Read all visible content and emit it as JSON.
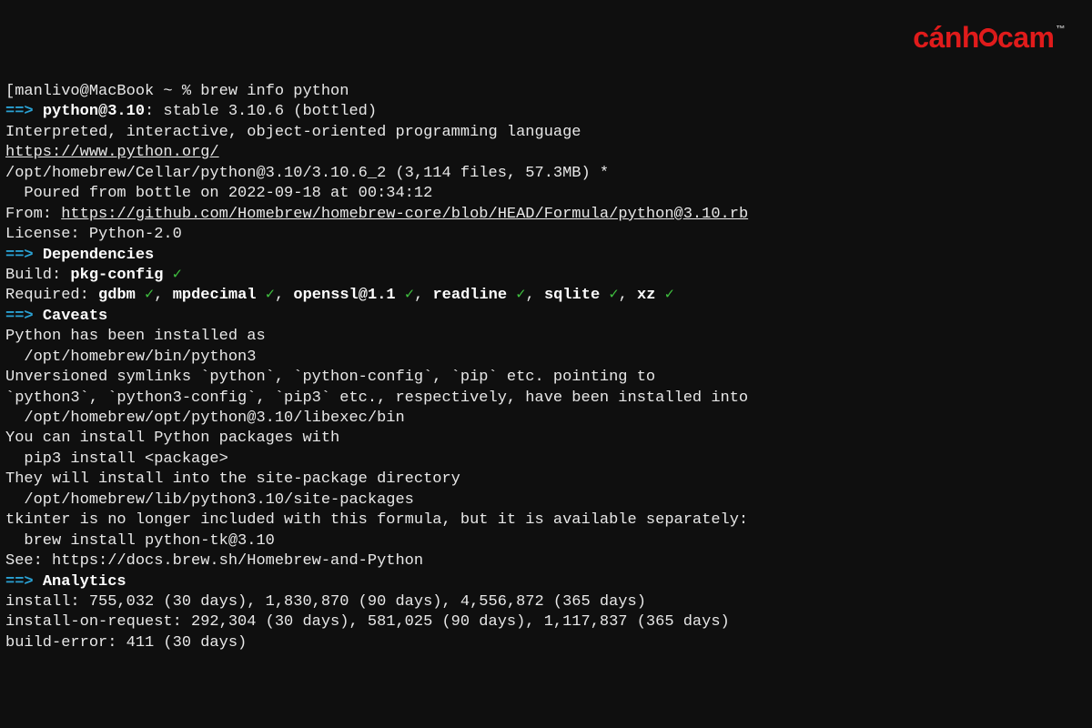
{
  "logo": {
    "text": "cánh",
    "text2": "cam",
    "tm": "™"
  },
  "prompt": "[manlivo@MacBook ~ % brew info python",
  "pkg_head": {
    "arrow": "==>",
    "name": "python@3.10",
    "rest": ": stable 3.10.6 (bottled)"
  },
  "desc": "Interpreted, interactive, object-oriented programming language",
  "homepage": "https://www.python.org/",
  "cellar": "/opt/homebrew/Cellar/python@3.10/3.10.6_2 (3,114 files, 57.3MB) *",
  "poured": "  Poured from bottle on 2022-09-18 at 00:34:12",
  "from_label": "From: ",
  "from_url": "https://github.com/Homebrew/homebrew-core/blob/HEAD/Formula/python@3.10.rb",
  "license": "License: Python-2.0",
  "deps_header": {
    "arrow": "==>",
    "label": "Dependencies"
  },
  "build_label": "Build: ",
  "build_pkg": "pkg-config",
  "check": "✓",
  "req_label": "Required: ",
  "req": [
    "gdbm",
    "mpdecimal",
    "openssl@1.1",
    "readline",
    "sqlite",
    "xz"
  ],
  "caveats_header": {
    "arrow": "==>",
    "label": "Caveats"
  },
  "caveats": [
    "Python has been installed as",
    "  /opt/homebrew/bin/python3",
    "",
    "Unversioned symlinks `python`, `python-config`, `pip` etc. pointing to",
    "`python3`, `python3-config`, `pip3` etc., respectively, have been installed into",
    "  /opt/homebrew/opt/python@3.10/libexec/bin",
    "",
    "You can install Python packages with",
    "  pip3 install <package>",
    "They will install into the site-package directory",
    "  /opt/homebrew/lib/python3.10/site-packages",
    "",
    "tkinter is no longer included with this formula, but it is available separately:",
    "  brew install python-tk@3.10",
    "",
    "See: https://docs.brew.sh/Homebrew-and-Python"
  ],
  "analytics_header": {
    "arrow": "==>",
    "label": "Analytics"
  },
  "analytics": [
    "install: 755,032 (30 days), 1,830,870 (90 days), 4,556,872 (365 days)",
    "install-on-request: 292,304 (30 days), 581,025 (90 days), 1,117,837 (365 days)",
    "build-error: 411 (30 days)"
  ]
}
